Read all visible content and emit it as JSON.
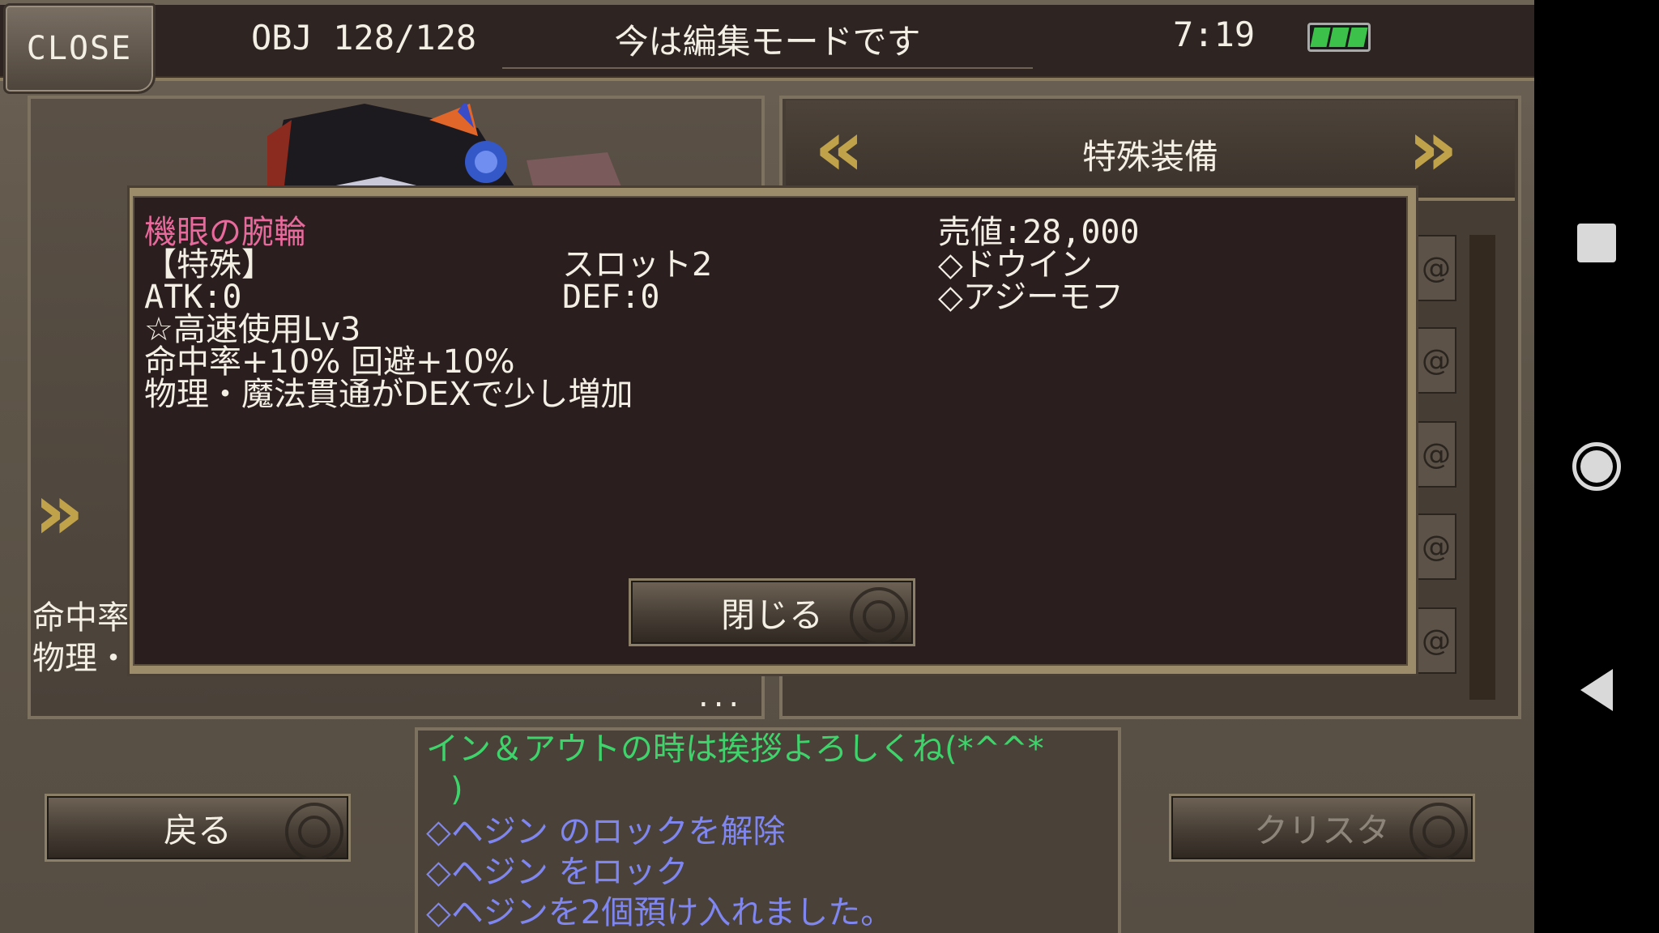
{
  "topbar": {
    "close_label": "CLOSE",
    "obj_label": "OBJ 128/128",
    "mode_text": "今は編集モードです",
    "time": "7:19"
  },
  "category": {
    "title": "特殊装備",
    "prev_icon": "double-chevron-left-icon",
    "next_icon": "double-chevron-right-icon"
  },
  "left_panel": {
    "stub_line1": "命中率",
    "stub_line2": "物理・",
    "dots": "..."
  },
  "item_detail": {
    "name": "機眼の腕輪",
    "category": "【特殊】",
    "slot": "スロット2",
    "atk": "ATK:0",
    "def": "DEF:0",
    "skill": "☆高速使用Lv3",
    "effect1": "命中率+10% 回避+10%",
    "effect2": "物理・魔法貫通がDEXで少し増加",
    "price": "売値:28,000",
    "source1": "◇ドウイン",
    "source2": "◇アジーモフ",
    "close_button": "閉じる"
  },
  "buttons": {
    "back": "戻る",
    "crysta": "クリスタ"
  },
  "chat": {
    "greet": "イン＆アウトの時は挨拶よろしくね(*^^*",
    "greet_cont": ")",
    "unlock": "◇ヘジン のロックを解除",
    "lock": "◇ヘジン をロック",
    "deposit": "◇ヘジンを2個預け入れました。"
  },
  "colors": {
    "item_name": "#e86a9c",
    "chat_greet": "#3fd46b",
    "chat_system": "#7f86f0",
    "arrow_gold": "#c0a24a"
  }
}
